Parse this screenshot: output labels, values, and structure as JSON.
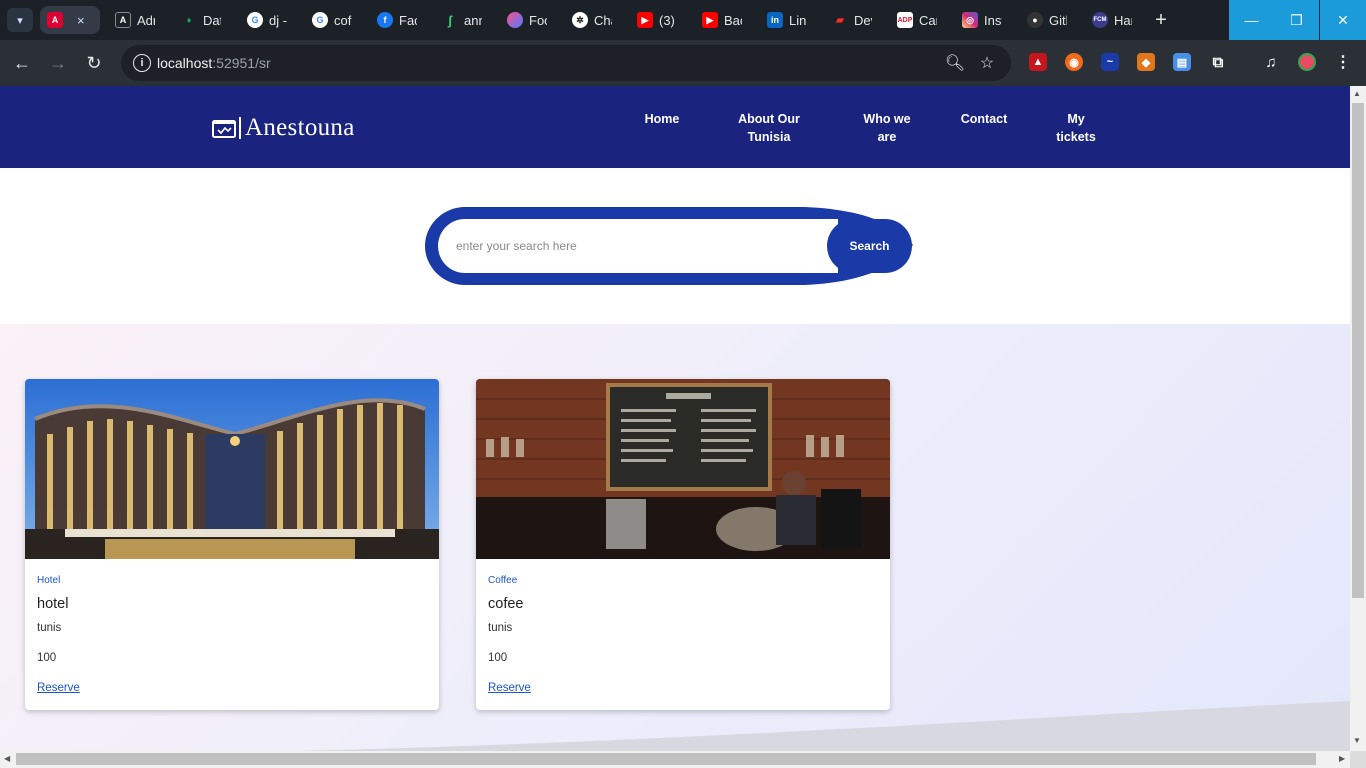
{
  "browser": {
    "tabs": [
      {
        "title": "Adr",
        "icon": "angular-icon",
        "color": "#dd0031"
      },
      {
        "title": "Dat",
        "icon": "mongodb-leaf-icon",
        "color": "#13aa52"
      },
      {
        "title": "dj -",
        "icon": "google-icon",
        "color": "#4285f4"
      },
      {
        "title": "cofe",
        "icon": "google-icon",
        "color": "#4285f4"
      },
      {
        "title": "Fac",
        "icon": "facebook-icon",
        "color": "#1877f2"
      },
      {
        "title": "ann",
        "icon": "green-loop-icon",
        "color": "#2e7d32"
      },
      {
        "title": "Foo",
        "icon": "gradient-icon",
        "color": "#7b4bd6"
      },
      {
        "title": "Cha",
        "icon": "chatgpt-icon",
        "color": "#ffffff"
      },
      {
        "title": "(3)",
        "icon": "youtube-icon",
        "color": "#ff0000"
      },
      {
        "title": "Bac",
        "icon": "youtube-icon",
        "color": "#ff0000"
      },
      {
        "title": "Link",
        "icon": "linkedin-icon",
        "color": "#0a66c2"
      },
      {
        "title": "Dev",
        "icon": "redhat-icon",
        "color": "#cc0000"
      },
      {
        "title": "Car",
        "icon": "adp-icon",
        "color": "#e31837"
      },
      {
        "title": "Inst",
        "icon": "instagram-icon",
        "color": "#d62976"
      },
      {
        "title": "Gith",
        "icon": "github-icon",
        "color": "#333333"
      },
      {
        "title": "Har",
        "icon": "fcm-icon",
        "color": "#3b3b8f"
      }
    ],
    "active_tab_close": "×",
    "new_tab_label": "+",
    "url_host": "localhost",
    "url_rest": ":52951/sr",
    "window": {
      "minimize": "—",
      "restore": "❐",
      "close": "✕"
    }
  },
  "site": {
    "logo_text": "Anestouna",
    "nav": [
      {
        "label": "Home"
      },
      {
        "label": "About Our Tunisia"
      },
      {
        "label": "Who we are"
      },
      {
        "label": "Contact"
      },
      {
        "label": "My tickets"
      }
    ],
    "search": {
      "placeholder": "enter your search here",
      "button_label": "Search"
    },
    "cards": [
      {
        "category": "Hotel",
        "title": "hotel",
        "location": "tunis",
        "price": "100",
        "link": "Reserve"
      },
      {
        "category": "Coffee",
        "title": "cofee",
        "location": "tunis",
        "price": "100",
        "link": "Reserve"
      }
    ]
  },
  "colors": {
    "header": "#1a237e",
    "search_button": "#1a3aa8",
    "link": "#1a56c8"
  }
}
